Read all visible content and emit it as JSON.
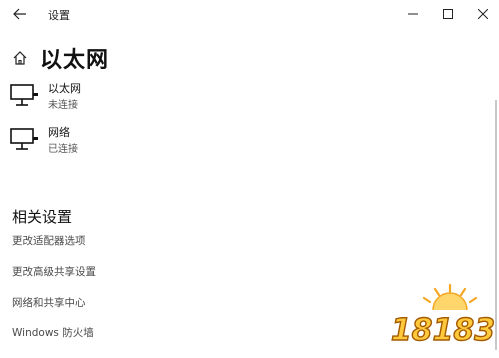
{
  "titlebar": {
    "app_title": "设置",
    "back_icon": "arrow-left-icon",
    "minimize_icon": "minimize-icon",
    "maximize_icon": "maximize-icon",
    "close_icon": "close-icon"
  },
  "header": {
    "home_icon": "home-icon",
    "title": "以太网"
  },
  "networks": [
    {
      "name": "以太网",
      "status": "未连接",
      "icon": "network-monitor-icon"
    },
    {
      "name": "网络",
      "status": "已连接",
      "icon": "network-monitor-icon"
    }
  ],
  "related": {
    "title": "相关设置",
    "links": [
      "更改适配器选项",
      "更改高级共享设置",
      "网络和共享中心",
      "Windows 防火墙"
    ]
  },
  "watermark": {
    "text": "18183"
  },
  "colors": {
    "background": "#ffffff",
    "text": "#111111",
    "secondary_text": "#555555",
    "watermark_fill": "#f5a623"
  }
}
